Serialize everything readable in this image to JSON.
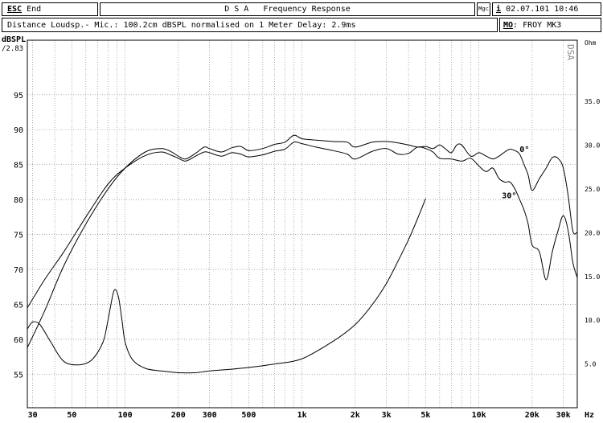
{
  "header": {
    "esc_key": "ESC",
    "esc_label": "End",
    "title": "D S A   Frequency Response",
    "mgc": "Mgc",
    "info_key": "i",
    "datetime": "02.07.101 10:46",
    "subtitle": "Distance Loudsp.- Mic.: 100.2cm dBSPL normalised on 1 Meter  Delay: 2.9ms",
    "mo_key": "MO",
    "model": ": FROY MK3"
  },
  "watermark": "DSA",
  "chart_data": {
    "type": "line",
    "xscale": "log",
    "xlim": [
      28,
      36000
    ],
    "ylim": [
      50.2,
      102.8
    ],
    "y2lim": [
      0,
      42
    ],
    "ylabel": "dBSPL",
    "y_offset_label": "/2.83",
    "xlabel": "Hz",
    "y2label": "Ohm",
    "grid": true,
    "x_ticks": [
      {
        "v": 30,
        "label": "30"
      },
      {
        "v": 50,
        "label": "50"
      },
      {
        "v": 100,
        "label": "100"
      },
      {
        "v": 200,
        "label": "200"
      },
      {
        "v": 300,
        "label": "300"
      },
      {
        "v": 500,
        "label": "500"
      },
      {
        "v": 1000,
        "label": "1k"
      },
      {
        "v": 2000,
        "label": "2k"
      },
      {
        "v": 3000,
        "label": "3k"
      },
      {
        "v": 5000,
        "label": "5k"
      },
      {
        "v": 10000,
        "label": "10k"
      },
      {
        "v": 20000,
        "label": "20k"
      },
      {
        "v": 30000,
        "label": "30k"
      }
    ],
    "x_gridlines": [
      30,
      40,
      50,
      60,
      70,
      80,
      90,
      100,
      200,
      300,
      400,
      500,
      600,
      700,
      800,
      900,
      1000,
      2000,
      3000,
      4000,
      5000,
      6000,
      7000,
      8000,
      9000,
      10000,
      20000,
      30000
    ],
    "y_ticks": [
      55,
      60,
      65,
      70,
      75,
      80,
      85,
      90,
      95
    ],
    "y2_ticks": [
      {
        "v": 5,
        "label": "5.0"
      },
      {
        "v": 10,
        "label": "10.0"
      },
      {
        "v": 15,
        "label": "15.0"
      },
      {
        "v": 20,
        "label": "20.0"
      },
      {
        "v": 25,
        "label": "25.0"
      },
      {
        "v": 30,
        "label": "30.0"
      },
      {
        "v": 35,
        "label": "35.0"
      }
    ],
    "series": [
      {
        "name": "0°",
        "axis": "left",
        "x": [
          28,
          35,
          45,
          60,
          80,
          100,
          130,
          160,
          180,
          200,
          220,
          250,
          280,
          300,
          350,
          400,
          450,
          500,
          600,
          700,
          800,
          900,
          1000,
          1200,
          1500,
          1800,
          2000,
          2500,
          3000,
          3500,
          4000,
          4500,
          5000,
          5500,
          6000,
          6500,
          7000,
          7500,
          8000,
          9000,
          10000,
          11000,
          12000,
          13000,
          14000,
          15000,
          16000,
          17000,
          18000,
          19000,
          20000,
          22000,
          24000,
          26000,
          28000,
          30000,
          32000,
          34000,
          36000
        ],
        "y": [
          58.8,
          64,
          70.5,
          76.5,
          81.5,
          84.5,
          86.8,
          87.3,
          86.9,
          86.2,
          85.8,
          86.6,
          87.5,
          87.3,
          86.8,
          87.4,
          87.6,
          87,
          87.3,
          87.9,
          88.2,
          89.2,
          88.7,
          88.5,
          88.3,
          88.2,
          87.5,
          88.2,
          88.3,
          88.1,
          87.8,
          87.5,
          87.6,
          87.3,
          87.8,
          87.2,
          86.7,
          87.8,
          87.8,
          86.2,
          86.7,
          86.2,
          85.8,
          86.2,
          86.8,
          87.2,
          87,
          86.5,
          85,
          83.5,
          81.3,
          83,
          84.5,
          86,
          85.9,
          84.5,
          80.5,
          75.5,
          75.3
        ]
      },
      {
        "name": "30°",
        "axis": "left",
        "x": [
          28,
          35,
          45,
          60,
          80,
          100,
          130,
          160,
          180,
          200,
          220,
          250,
          280,
          300,
          350,
          400,
          450,
          500,
          600,
          700,
          800,
          900,
          1000,
          1200,
          1500,
          1800,
          2000,
          2500,
          3000,
          3500,
          4000,
          4500,
          5000,
          5500,
          6000,
          7000,
          8000,
          9000,
          10000,
          11000,
          12000,
          13000,
          14000,
          15000,
          16000,
          17000,
          18000,
          19000,
          20000,
          22000,
          24000,
          26000,
          28000,
          30000,
          32000,
          34000,
          36000
        ],
        "y": [
          64.5,
          68.5,
          72.5,
          77.5,
          82.2,
          84.5,
          86.3,
          86.8,
          86.4,
          85.9,
          85.5,
          86.2,
          86.8,
          86.7,
          86.2,
          86.7,
          86.5,
          86.1,
          86.4,
          86.9,
          87.2,
          88.2,
          88,
          87.5,
          87,
          86.5,
          85.8,
          86.9,
          87.3,
          86.5,
          86.6,
          87.5,
          87.3,
          86.8,
          85.9,
          85.8,
          85.5,
          85.9,
          84.8,
          84,
          84.5,
          83,
          82.5,
          82.5,
          81.5,
          80,
          78.5,
          76.5,
          73.5,
          72.5,
          68.5,
          72.5,
          75.5,
          77.7,
          75.5,
          71,
          68.8
        ]
      },
      {
        "name": "Impedance",
        "axis": "right",
        "x": [
          28,
          30,
          33,
          38,
          45,
          55,
          65,
          75,
          80,
          85,
          88,
          92,
          96,
          100,
          110,
          130,
          160,
          200,
          250,
          300,
          400,
          500,
          700,
          1000,
          1500,
          2000,
          2500,
          3000,
          3500,
          4000,
          4500,
          5000
        ],
        "y": [
          9,
          9.8,
          9.5,
          7.5,
          5.3,
          4.9,
          5.5,
          7.5,
          10,
          12.8,
          13.5,
          12.5,
          10,
          7.5,
          5.5,
          4.5,
          4.2,
          4,
          4,
          4.2,
          4.4,
          4.6,
          5,
          5.6,
          7.6,
          9.5,
          11.8,
          14.2,
          16.8,
          19.2,
          21.6,
          23.9
        ]
      }
    ],
    "annotations": [
      {
        "text": "0°",
        "x": 17000,
        "y": 86.8
      },
      {
        "text": "30°",
        "x": 13500,
        "y": 80.2
      }
    ]
  }
}
